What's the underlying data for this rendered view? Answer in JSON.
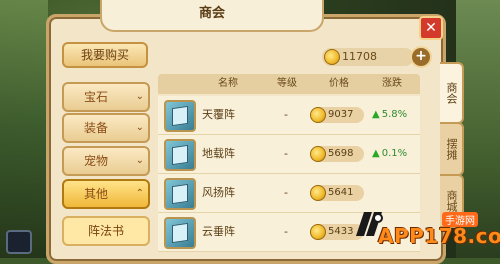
{
  "panel": {
    "title": "商会"
  },
  "buy_button": "我要购买",
  "currency": {
    "amount": "11708"
  },
  "categories": [
    {
      "label": "宝石",
      "chevron": "⌄"
    },
    {
      "label": "装备",
      "chevron": "⌄"
    },
    {
      "label": "宠物",
      "chevron": "⌄"
    },
    {
      "label": "其他",
      "chevron": "⌃"
    }
  ],
  "subcategory": "阵法书",
  "table": {
    "headers": [
      "名称",
      "等级",
      "价格",
      "涨跌"
    ],
    "rows": [
      {
        "name": "天覆阵",
        "level": "-",
        "price": "9037",
        "change": "5.8%"
      },
      {
        "name": "地载阵",
        "level": "-",
        "price": "5698",
        "change": "0.1%"
      },
      {
        "name": "风扬阵",
        "level": "-",
        "price": "5641",
        "change": ""
      },
      {
        "name": "云垂阵",
        "level": "-",
        "price": "5433",
        "change": ""
      }
    ]
  },
  "side_tabs": [
    "商会",
    "摆摊",
    "商城"
  ],
  "watermark": {
    "text": "APP178.com",
    "sub": "手游网"
  },
  "colors": {
    "accent": "#f0b83a",
    "up": "#27a827",
    "close": "#d43a2b"
  }
}
